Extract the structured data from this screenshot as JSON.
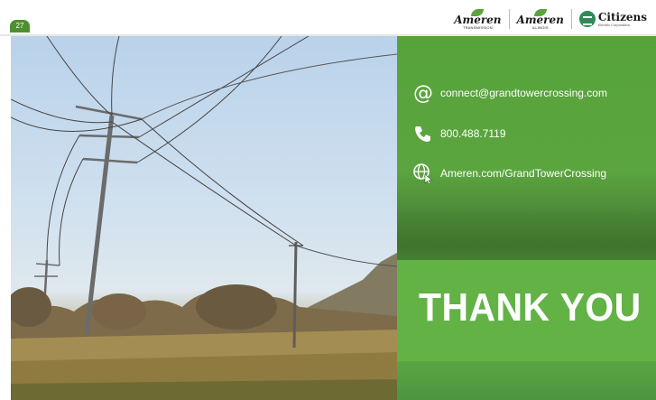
{
  "slide": {
    "number": "27"
  },
  "logos": {
    "ameren_transmission": {
      "word": "Ameren",
      "sub": "TRANSMISSION"
    },
    "ameren_illinois": {
      "word": "Ameren",
      "sub": "ILLINOIS"
    },
    "citizens": {
      "word": "Citizens",
      "sub": "Electric Corporation"
    }
  },
  "contacts": {
    "email": "connect@grandtowercrossing.com",
    "phone": "800.488.7119",
    "web": "Ameren.com/GrandTowerCrossing"
  },
  "thank_you": "THANK YOU",
  "colors": {
    "green_panel": "#6ab04c",
    "green_dark": "#4f8f2f",
    "white": "#ffffff"
  },
  "icons": {
    "email": "at-sign-icon",
    "phone": "phone-icon",
    "web": "globe-cursor-icon"
  }
}
